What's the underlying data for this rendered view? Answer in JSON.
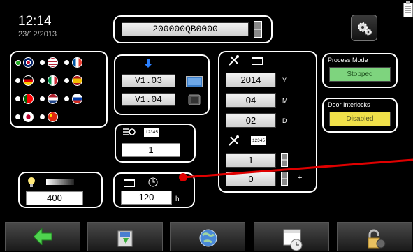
{
  "header": {
    "time": "12:14",
    "date": "23/12/2013",
    "serial": "200000QB0000"
  },
  "languages": {
    "selected": "uk",
    "flags": [
      "uk",
      "usa",
      "france",
      "germany",
      "italy",
      "spain",
      "portugal",
      "netherlands",
      "russia",
      "japan",
      "china"
    ]
  },
  "versions": {
    "first": "V1.03",
    "second": "V1.04"
  },
  "fan": {
    "counter_label": "12345",
    "value": "1"
  },
  "lamp": {
    "value": "400"
  },
  "timer": {
    "value": "120",
    "unit": "h"
  },
  "service_date": {
    "year": "2014",
    "year_unit": "Y",
    "month": "04",
    "month_unit": "M",
    "day": "02",
    "day_unit": "D",
    "counter_label": "12345",
    "count_a": "1",
    "count_b": "0",
    "plus": "+"
  },
  "process_mode": {
    "title": "Process Mode",
    "value": "Stopped",
    "color": "#7ed47e"
  },
  "door_interlocks": {
    "title": "Door Interlocks",
    "value": "Disabled",
    "color": "#f0e04a"
  },
  "toolbar": {
    "items": [
      "back-arrow-icon",
      "save-icon",
      "globe-icon",
      "calendar-clock-icon",
      "unlock-icon"
    ]
  },
  "colors": {
    "accent_line": "#e00000",
    "window_blue": "#3c7ec9"
  }
}
